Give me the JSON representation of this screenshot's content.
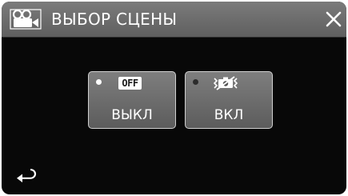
{
  "header": {
    "title": "ВЫБОР СЦЕНЫ",
    "mode_icon": "video-camera-icon",
    "close_icon": "close-icon"
  },
  "options": [
    {
      "label": "ВЫКЛ",
      "icon": "off-icon",
      "icon_text": "OFF",
      "selected": true
    },
    {
      "label": "ВКЛ",
      "icon": "shake-reduction-icon",
      "selected": false
    }
  ],
  "footer": {
    "back_icon": "back-arrow-icon"
  },
  "colors": {
    "screen_bg": "#080808",
    "header_bg": "#6e6e6e",
    "button_bg": "#6e6e6e",
    "text": "#ffffff"
  }
}
